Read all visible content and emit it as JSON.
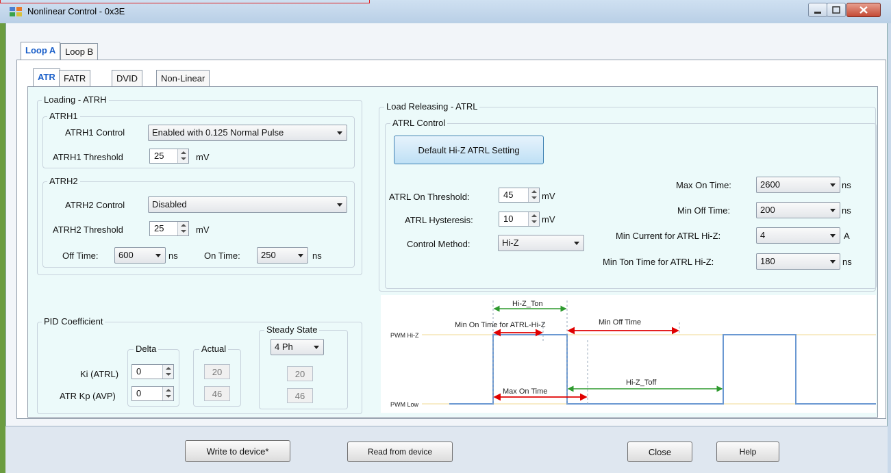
{
  "window": {
    "title": "Nonlinear Control - 0x3E"
  },
  "outer_tabs": [
    {
      "label": "Loop A"
    },
    {
      "label": "Loop B"
    }
  ],
  "inner_tabs": [
    {
      "label": "ATR"
    },
    {
      "label": "FATR"
    },
    {
      "label": "DVID"
    },
    {
      "label": "Non-Linear"
    }
  ],
  "loading": {
    "title": "Loading - ATRH",
    "atrh1": {
      "title": "ATRH1",
      "control_label": "ATRH1 Control",
      "control_value": "Enabled with 0.125 Normal Pulse",
      "threshold_label": "ATRH1 Threshold",
      "threshold_value": "25",
      "threshold_unit": "mV"
    },
    "atrh2": {
      "title": "ATRH2",
      "control_label": "ATRH2 Control",
      "control_value": "Disabled",
      "threshold_label": "ATRH2 Threshold",
      "threshold_value": "25",
      "threshold_unit": "mV",
      "off_time_label": "Off Time:",
      "off_time_value": "600",
      "off_time_unit": "ns",
      "on_time_label": "On Time:",
      "on_time_value": "250",
      "on_time_unit": "ns"
    }
  },
  "pid": {
    "title": "PID Coefficient",
    "delta_title": "Delta",
    "actual_title": "Actual",
    "steady_title": "Steady State",
    "steady_phase": "4 Ph",
    "ki_label": "Ki (ATRL)",
    "kp_label": "ATR Kp (AVP)",
    "ki_delta": "0",
    "kp_delta": "0",
    "ki_actual": "20",
    "kp_actual": "46",
    "ki_steady": "20",
    "kp_steady": "46"
  },
  "releasing": {
    "title": "Load Releasing - ATRL",
    "control_title": "ATRL Control",
    "default_button": "Default Hi-Z ATRL Setting",
    "on_threshold_label": "ATRL On Threshold:",
    "on_threshold_value": "45",
    "on_threshold_unit": "mV",
    "hysteresis_label": "ATRL Hysteresis:",
    "hysteresis_value": "10",
    "hysteresis_unit": "mV",
    "method_label": "Control Method:",
    "method_value": "Hi-Z",
    "max_on_label": "Max On Time:",
    "max_on_value": "2600",
    "max_on_unit": "ns",
    "min_off_label": "Min Off Time:",
    "min_off_value": "200",
    "min_off_unit": "ns",
    "min_current_label": "Min Current for ATRL Hi-Z:",
    "min_current_value": "4",
    "min_current_unit": "A",
    "min_ton_label": "Min Ton Time for ATRL Hi-Z:",
    "min_ton_value": "180",
    "min_ton_unit": "ns"
  },
  "diagram": {
    "hiz_ton": "Hi-Z_Ton",
    "min_on_time": "Min On Time for ATRL-Hi-Z",
    "min_off_time": "Min Off Time",
    "pwm_hiz": "PWM Hi-Z",
    "max_on_time": "Max On Time",
    "hiz_toff": "Hi-Z_Toff",
    "pwm_low": "PWM Low"
  },
  "footer": {
    "write": "Write to device*",
    "read": "Read from device",
    "close": "Close",
    "help": "Help"
  },
  "colors": {
    "active_tab": "#1a5fc9",
    "panel": "#ecfafa",
    "arrow_red": "#e00000",
    "arrow_green": "#2e9a2e"
  }
}
